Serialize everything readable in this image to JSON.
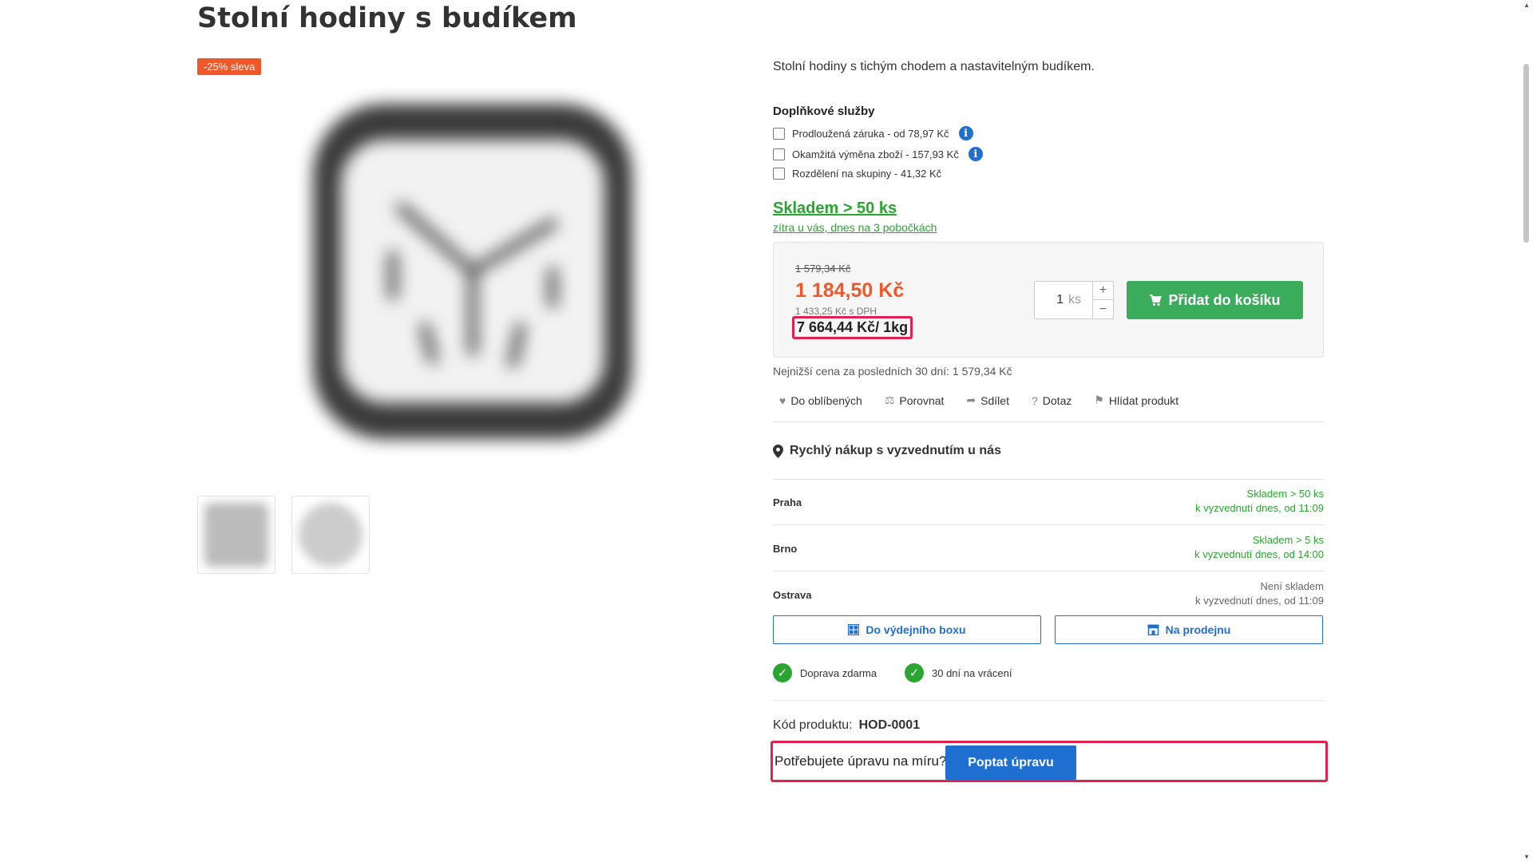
{
  "page": {
    "title": "Stolní hodiny s budíkem"
  },
  "gallery": {
    "badge": "-25% sleva"
  },
  "product": {
    "description": "Stolní hodiny s tichým chodem a nastavitelným budíkem.",
    "addons_title": "Doplňkové služby",
    "addons": [
      {
        "label": "Prodloužená záruka - od 78,97 Kč",
        "info": "i"
      },
      {
        "label": "Okamžitá výměna zboží - 157,93 Kč",
        "info": "i"
      },
      {
        "label": "Rozdělení na skupiny - 41,32 Kč"
      }
    ],
    "stock_main": "Skladem > 50 ks",
    "stock_sub": "zítra u vás, dnes na 3 pobočkách"
  },
  "price": {
    "old": "1 579,34 Kč",
    "current": "1 184,50 Kč",
    "vat": "1 433,25 Kč s DPH",
    "unit": "7 664,44 Kč/ 1kg",
    "qty_value": "1",
    "qty_unit": "ks",
    "add_to_cart": "Přidat do košíku",
    "lowest": "Nejnižší cena za posledních 30 dní: 1 579,34 Kč"
  },
  "actions": [
    {
      "label": "Do oblíbených",
      "icon": "heart-icon"
    },
    {
      "label": "Porovnat",
      "icon": "scale-icon"
    },
    {
      "label": "Sdílet",
      "icon": "share-icon"
    },
    {
      "label": "Dotaz",
      "icon": "question-icon"
    },
    {
      "label": "Hlídat produkt",
      "icon": "watch-icon"
    }
  ],
  "pickup": {
    "title": "Rychlý nákup s vyzvednutím u nás",
    "branches": [
      {
        "name": "Praha",
        "status": "Skladem > 50 ks",
        "time": "k vyzvednutí dnes, od 11:09"
      },
      {
        "name": "Brno",
        "status": "Skladem > 5 ks",
        "time": "k vyzvednutí dnes, od 14:00"
      },
      {
        "name": "Ostrava",
        "status": "Není skladem",
        "time": "k vyzvednutí dnes, od 11:09"
      }
    ],
    "box_button": "Do výdejního boxu",
    "store_button": "Na prodejnu"
  },
  "perks": [
    "Doprava zdarma",
    "30 dní na vrácení"
  ],
  "code": {
    "label": "Kód produktu:",
    "value": "HOD-0001"
  },
  "custom": {
    "question": "Potřebujete úpravu na míru?",
    "button": "Poptat úpravu"
  },
  "colors": {
    "accent": "#f0582a",
    "green": "#2aa52f",
    "blue": "#1e6fd0",
    "highlight": "#e0234e"
  }
}
